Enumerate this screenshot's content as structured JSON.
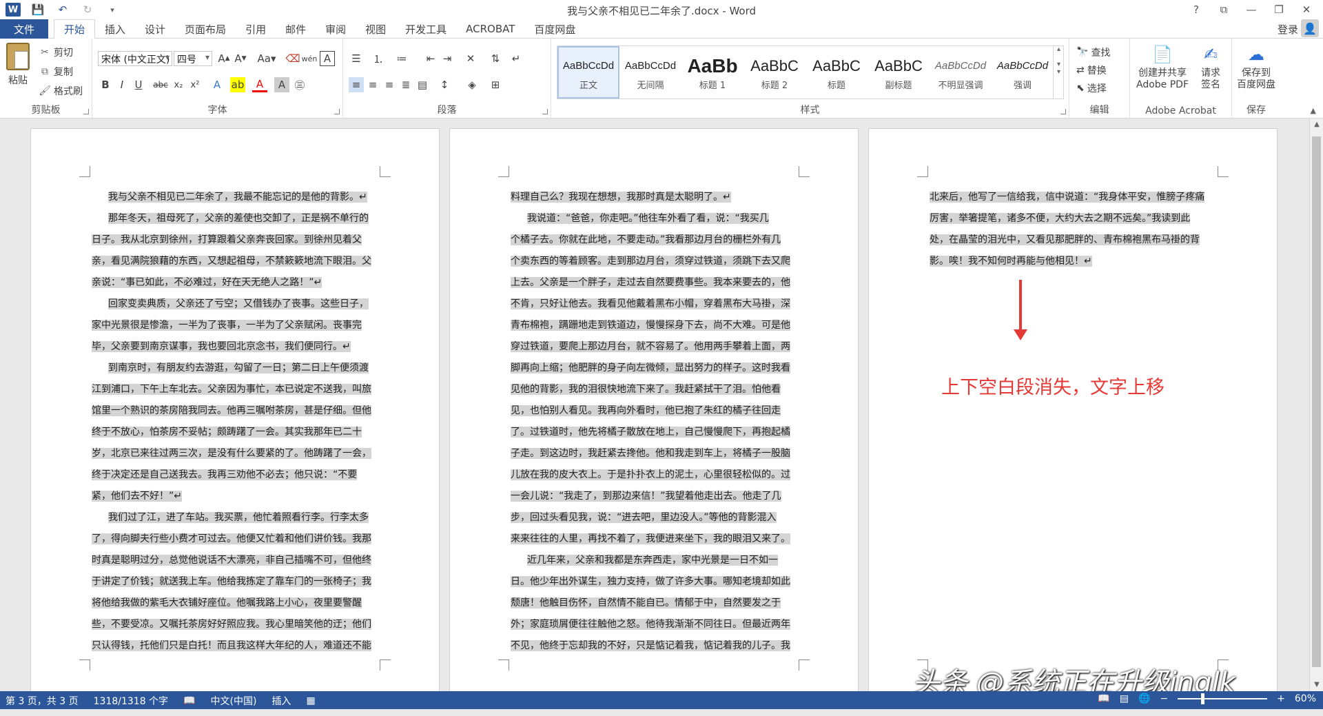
{
  "window": {
    "title": "我与父亲不相见已二年余了.docx - Word",
    "controls": [
      "?",
      "⧉",
      "—",
      "❐",
      "✕"
    ]
  },
  "ribbon_tabs": {
    "file": "文件",
    "tabs": [
      "开始",
      "插入",
      "设计",
      "页面布局",
      "引用",
      "邮件",
      "审阅",
      "视图",
      "开发工具",
      "ACROBAT",
      "百度网盘"
    ],
    "active": "开始",
    "signin": "登录"
  },
  "clipboard": {
    "paste": "粘贴",
    "cut": "剪切",
    "copy": "复制",
    "format_painter": "格式刷",
    "label": "剪贴板"
  },
  "font": {
    "name": "宋体 (中文正文)",
    "size": "四号",
    "label": "字体"
  },
  "paragraph": {
    "label": "段落"
  },
  "styles": {
    "items": [
      {
        "sample": "AaBbCcDd",
        "name": "正文"
      },
      {
        "sample": "AaBbCcDd",
        "name": "无间隔"
      },
      {
        "sample": "AaBb",
        "name": "标题 1"
      },
      {
        "sample": "AaBbC",
        "name": "标题 2"
      },
      {
        "sample": "AaBbC",
        "name": "标题"
      },
      {
        "sample": "AaBbC",
        "name": "副标题"
      },
      {
        "sample": "AaBbCcDd",
        "name": "不明显强调"
      },
      {
        "sample": "AaBbCcDd",
        "name": "强调"
      }
    ],
    "label": "样式"
  },
  "editing": {
    "find": "查找",
    "replace": "替换",
    "select": "选择",
    "label": "编辑"
  },
  "acrobat": {
    "create_share": "创建并共享",
    "create_share_2": "Adobe PDF",
    "request_sign": "请求",
    "request_sign_2": "签名",
    "label": "Adobe Acrobat"
  },
  "save": {
    "save_to": "保存到",
    "save_to_2": "百度网盘",
    "label": "保存"
  },
  "pages": {
    "page1": [
      "我与父亲不相见已二年余了，我最不能忘记的是他的背影。↵",
      "那年冬天，祖母死了，父亲的差使也交卸了，正是祸不单行的",
      "日子。我从北京到徐州，打算跟着父亲奔丧回家。到徐州见着父",
      "亲，看见满院狼藉的东西，又想起祖母，不禁簌簌地流下眼泪。父",
      "亲说：“事已如此，不必难过，好在天无绝人之路！”↵",
      "回家变卖典质，父亲还了亏空；又借钱办了丧事。这些日子，",
      "家中光景很是惨澹，一半为了丧事，一半为了父亲赋闲。丧事完",
      "毕，父亲要到南京谋事，我也要回北京念书，我们便同行。↵",
      "到南京时，有朋友约去游逛，勾留了一日；第二日上午便须渡",
      "江到浦口，下午上车北去。父亲因为事忙，本已说定不送我，叫旅",
      "馆里一个熟识的茶房陪我同去。他再三嘱咐茶房，甚是仔细。但他",
      "终于不放心，怕茶房不妥帖；颇踌躇了一会。其实我那年已二十",
      "岁，北京已来往过两三次，是没有什么要紧的了。他踌躇了一会，",
      "终于决定还是自己送我去。我再三劝他不必去；他只说：“不要",
      "紧，他们去不好！”↵",
      "我们过了江，进了车站。我买票，他忙着照看行李。行李太多",
      "了，得向脚夫行些小费才可过去。他便又忙着和他们讲价钱。我那",
      "时真是聪明过分，总觉他说话不大漂亮，非自己插嘴不可，但他终",
      "于讲定了价钱；就送我上车。他给我拣定了靠车门的一张椅子；我",
      "将他给我做的紫毛大衣铺好座位。他嘱我路上小心，夜里要警醒",
      "些，不要受凉。又嘱托茶房好好照应我。我心里暗笑他的迂；他们",
      "只认得钱，托他们只是白托！而且我这样大年纪的人，难道还不能"
    ],
    "page2": [
      "料理自己么？我现在想想，我那时真是太聪明了。↵",
      "我说道：“爸爸，你走吧。”他往车外看了看，说：“我买几",
      "个橘子去。你就在此地，不要走动。”我看那边月台的栅栏外有几",
      "个卖东西的等着顾客。走到那边月台，须穿过铁道，须跳下去又爬",
      "上去。父亲是一个胖子，走过去自然要费事些。我本来要去的，他",
      "不肯，只好让他去。我看见他戴着黑布小帽，穿着黑布大马褂，深",
      "青布棉袍，蹒跚地走到铁道边，慢慢探身下去，尚不大难。可是他",
      "穿过铁道，要爬上那边月台，就不容易了。他用两手攀着上面，两",
      "脚再向上缩；他肥胖的身子向左微倾，显出努力的样子。这时我看",
      "见他的背影，我的泪很快地流下来了。我赶紧拭干了泪。怕他看",
      "见，也怕别人看见。我再向外看时，他已抱了朱红的橘子往回走",
      "了。过铁道时，他先将橘子散放在地上，自己慢慢爬下，再抱起橘",
      "子走。到这边时，我赶紧去搀他。他和我走到车上，将橘子一股脑",
      "儿放在我的皮大衣上。于是扑扑衣上的泥土，心里很轻松似的。过",
      "一会儿说：“我走了，到那边来信！”我望着他走出去。他走了几",
      "步，回过头看见我，说：“进去吧，里边没人。”等他的背影混入",
      "来来往往的人里，再找不着了，我便进来坐下，我的眼泪又来了。↵",
      "近几年来，父亲和我都是东奔西走，家中光景是一日不如一",
      "日。他少年出外谋生，独力支持，做了许多大事。哪知老境却如此",
      "颓唐！他触目伤怀，自然情不能自已。情郁于中，自然要发之于",
      "外；家庭琐屑便往往触他之怒。他待我渐渐不同往日。但最近两年",
      "不见，他终于忘却我的不好，只是惦记着我，惦记着我的儿子。我"
    ],
    "page3": [
      "北来后，他写了一信给我，信中说道：“我身体平安，惟膀子疼痛",
      "厉害，举箸提笔，诸多不便，大约大去之期不远矣。”我读到此",
      "处，在晶莹的泪光中，又看见那肥胖的、青布棉袍黑布马褂的背",
      "影。唉！我不知何时再能与他相见！↵"
    ]
  },
  "annotation": {
    "text": "上下空白段消失，文字上移",
    "color": "#e53935"
  },
  "watermark": "头条 @系统正在升级inglk",
  "statusbar": {
    "page": "第 3 页，共 3 页",
    "words": "1318/1318 个字",
    "language": "中文(中国)",
    "mode": "插入",
    "zoom": "60%",
    "zoom_fraction": 0.27
  },
  "colors": {
    "accent": "#2b579a",
    "highlight": "#d4d4d4",
    "annotation": "#e53935"
  }
}
